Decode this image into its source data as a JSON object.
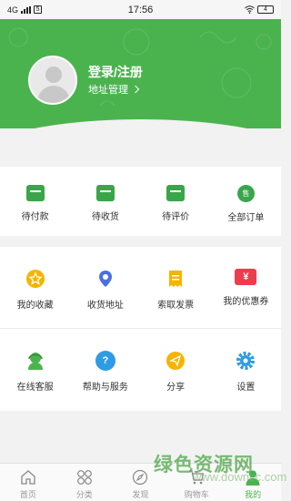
{
  "status_bar": {
    "network": "4G",
    "box_label": "5",
    "time": "17:56",
    "battery": "4"
  },
  "profile": {
    "login_label": "登录/注册",
    "address_label": "地址管理"
  },
  "orders": [
    {
      "label": "待付款",
      "icon": "wallet-icon",
      "color": "#3aa54a"
    },
    {
      "label": "待收货",
      "icon": "package-icon",
      "color": "#3aa54a"
    },
    {
      "label": "待评价",
      "icon": "review-icon",
      "color": "#3aa54a"
    },
    {
      "label": "全部订单",
      "icon": "sale-icon",
      "badge": "售",
      "color": "#3aa54a"
    }
  ],
  "services": {
    "row1": [
      {
        "label": "我的收藏",
        "icon": "star-icon",
        "color": "#f5b400"
      },
      {
        "label": "收货地址",
        "icon": "location-pin-icon",
        "color": "#4a6fe3"
      },
      {
        "label": "索取发票",
        "icon": "invoice-icon",
        "color": "#f5b400"
      },
      {
        "label": "我的优惠券",
        "icon": "coupon-icon",
        "color": "#ef3b4e",
        "symbol": "¥"
      }
    ],
    "row2": [
      {
        "label": "在线客服",
        "icon": "customer-service-icon",
        "color": "#4bb34e"
      },
      {
        "label": "帮助与服务",
        "icon": "help-icon",
        "color": "#2f9be4",
        "symbol": "?"
      },
      {
        "label": "分享",
        "icon": "share-icon",
        "color": "#f5b400"
      },
      {
        "label": "设置",
        "icon": "gear-icon",
        "color": "#2f9be4"
      }
    ]
  },
  "tabs": [
    {
      "label": "首页",
      "icon": "home-icon"
    },
    {
      "label": "分类",
      "icon": "category-icon"
    },
    {
      "label": "发现",
      "icon": "compass-icon"
    },
    {
      "label": "购物车",
      "icon": "cart-icon"
    },
    {
      "label": "我的",
      "icon": "user-icon",
      "active": true
    }
  ],
  "colors": {
    "brand": "#4bb34e",
    "active_tab": "#4bb34e"
  },
  "watermark": {
    "cn": "绿色资源网",
    "en": "www.downcc.com"
  }
}
